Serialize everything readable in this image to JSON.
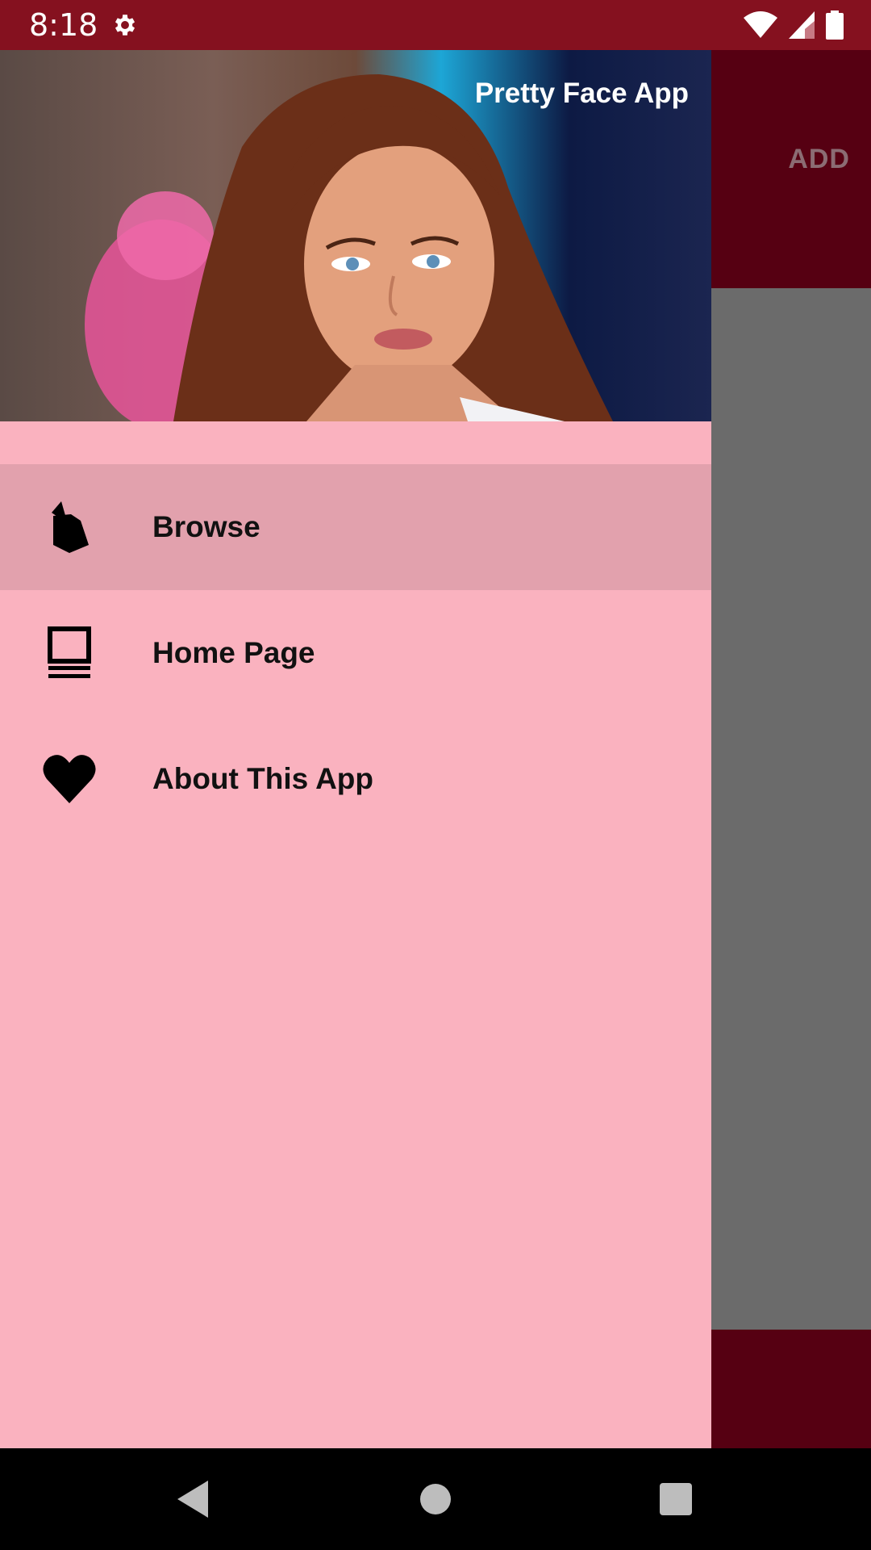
{
  "status_bar": {
    "time": "8:18",
    "icons": [
      "gear-icon",
      "wifi-icon",
      "signal-icon",
      "battery-icon"
    ]
  },
  "background_app": {
    "toolbar_action": "ADD",
    "colors": {
      "toolbar": "#560012",
      "scrim": "#6b6b6b"
    }
  },
  "drawer": {
    "title": "Pretty Face App",
    "header_image": "portrait-photo",
    "items": [
      {
        "label": "Browse",
        "icon": "firebase-icon",
        "active": true
      },
      {
        "label": "Home Page",
        "icon": "laptop-icon",
        "active": false
      },
      {
        "label": "About This App",
        "icon": "heart-icon",
        "active": false
      }
    ],
    "colors": {
      "background": "#fab2bf",
      "active": "#e2a1ad"
    }
  },
  "navigation_bar": {
    "buttons": [
      "back-icon",
      "home-icon",
      "recents-icon"
    ]
  }
}
